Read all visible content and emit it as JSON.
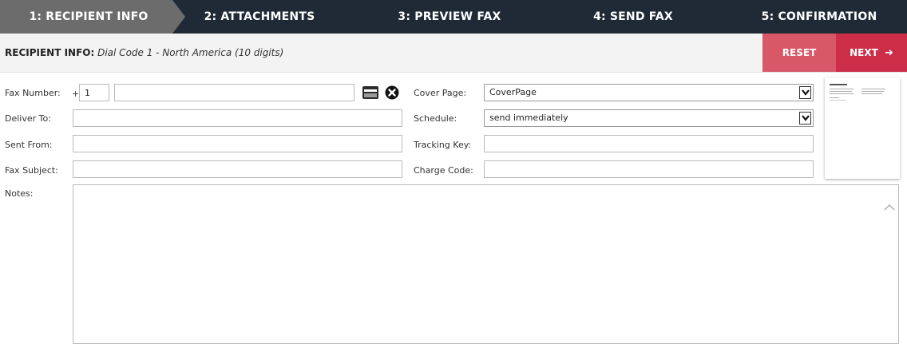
{
  "steps": [
    {
      "label": "1: RECIPIENT INFO",
      "active": true
    },
    {
      "label": "2: ATTACHMENTS"
    },
    {
      "label": "3: PREVIEW FAX"
    },
    {
      "label": "4: SEND FAX"
    },
    {
      "label": "5: CONFIRMATION"
    }
  ],
  "header": {
    "title": "RECIPIENT INFO:",
    "subtitle": "Dial Code 1 - North America (10 digits)",
    "reset_label": "RESET",
    "next_label": "NEXT"
  },
  "form": {
    "fax_number": {
      "label": "Fax Number:",
      "plus": "+",
      "country_code": "1",
      "value": ""
    },
    "deliver_to": {
      "label": "Deliver To:",
      "value": ""
    },
    "sent_from": {
      "label": "Sent From:",
      "value": ""
    },
    "fax_subject": {
      "label": "Fax Subject:",
      "value": ""
    },
    "notes": {
      "label": "Notes:",
      "value": ""
    },
    "cover_page": {
      "label": "Cover Page:",
      "selected": "CoverPage"
    },
    "schedule": {
      "label": "Schedule:",
      "selected": "send immediately"
    },
    "tracking_key": {
      "label": "Tracking Key:",
      "value": ""
    },
    "charge_code": {
      "label": "Charge Code:",
      "value": ""
    }
  },
  "icons": {
    "contact_card": "contact-card-icon",
    "clear": "clear-x-icon",
    "chevron": "chevron-down-icon",
    "scroll_up": "scroll-up-icon"
  },
  "colors": {
    "steps_bg": "#1f2a36",
    "active_step": "#6c6c6c",
    "reset": "#d85868",
    "next": "#cc2e48"
  }
}
